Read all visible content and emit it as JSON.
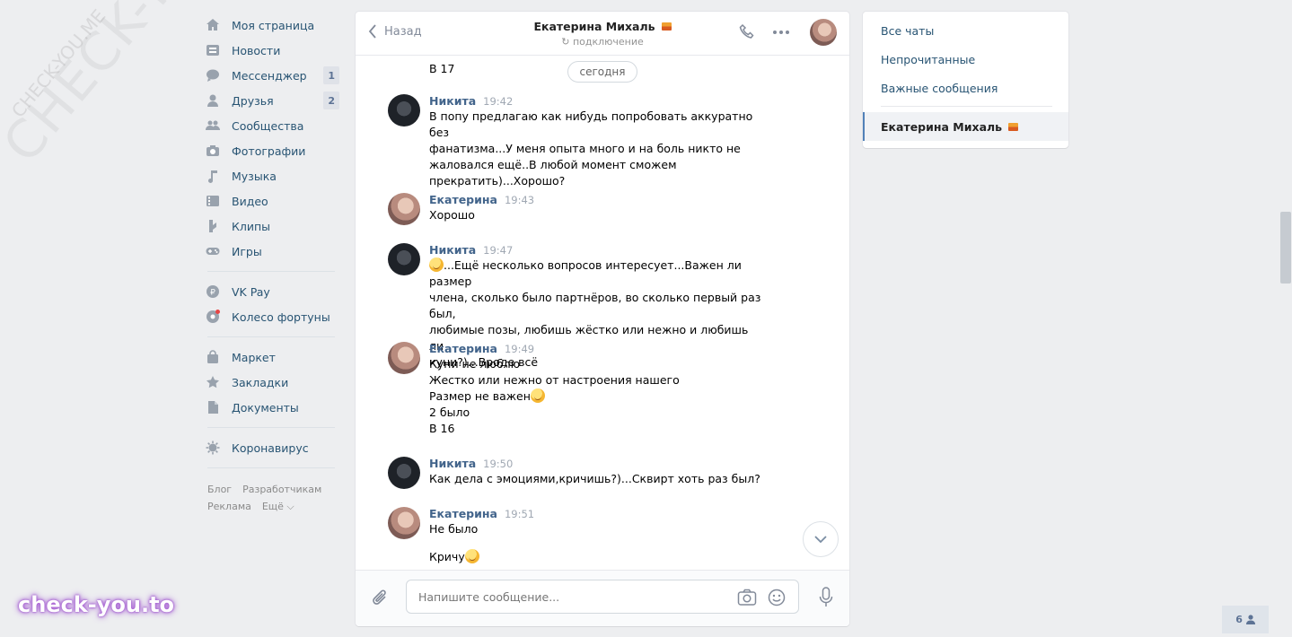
{
  "watermark": {
    "big": "CHECK-YOU.ME",
    "small": "CHECK-YOU.ME",
    "logo": "check-you.to"
  },
  "nav": {
    "items": [
      {
        "label": "Моя страница",
        "icon": "home-icon"
      },
      {
        "label": "Новости",
        "icon": "news-icon"
      },
      {
        "label": "Мессенджер",
        "icon": "messenger-icon",
        "count": "1"
      },
      {
        "label": "Друзья",
        "icon": "friends-icon",
        "count": "2"
      },
      {
        "label": "Сообщества",
        "icon": "groups-icon"
      },
      {
        "label": "Фотографии",
        "icon": "camera-icon"
      },
      {
        "label": "Музыка",
        "icon": "music-icon"
      },
      {
        "label": "Видео",
        "icon": "video-icon"
      },
      {
        "label": "Клипы",
        "icon": "clips-icon"
      },
      {
        "label": "Игры",
        "icon": "games-icon"
      }
    ],
    "pay": [
      {
        "label": "VK Pay",
        "icon": "vkpay-icon"
      },
      {
        "label": "Колесо фортуны",
        "icon": "wheel-icon"
      }
    ],
    "more": [
      {
        "label": "Маркет",
        "icon": "market-icon"
      },
      {
        "label": "Закладки",
        "icon": "bookmark-icon"
      },
      {
        "label": "Документы",
        "icon": "document-icon"
      }
    ],
    "corona": {
      "label": "Коронавирус",
      "icon": "virus-icon"
    },
    "footer": {
      "blog": "Блог",
      "dev": "Разработчикам",
      "ads": "Реклама",
      "more": "Ещё ⌵"
    }
  },
  "chat": {
    "back_label": "Назад",
    "name": "Екатерина Михаль",
    "status": "подключение",
    "date_pill": "сегодня",
    "top_continuation": "В 17",
    "messages": [
      {
        "author": "Никита",
        "time": "19:42",
        "lines": [
          "В попу предлагаю как нибудь попробовать аккуратно без",
          "фанатизма...У меня опыта много и на боль никто не",
          "жаловался ещё..В любой момент сможем",
          "прекратить)...Хорошо?"
        ]
      },
      {
        "author": "Екатерина",
        "time": "19:43",
        "lines": [
          "Хорошо"
        ]
      },
      {
        "author": "Никита",
        "time": "19:47",
        "lines": [
          "...Ещё несколько вопросов интересует...Важен ли размер",
          "члена, сколько было партнёров, во сколько первый раз был,",
          "любимые позы, любишь жёстко или нежно и любишь ли",
          "куни?)...Вроде всё"
        ]
      },
      {
        "author": "Екатерина",
        "time": "19:49",
        "lines": [
          "Куни не люблю",
          "Жестко или нежно от настроения нашего",
          "Размер не важен",
          "2 было",
          "В 16"
        ]
      },
      {
        "author": "Никита",
        "time": "19:50",
        "lines": [
          "Как дела с эмоциями,кричишь?)...Сквирт хоть раз был?"
        ]
      },
      {
        "author": "Екатерина",
        "time": "19:51",
        "lines": [
          "Не было",
          "",
          "Кричу"
        ]
      }
    ],
    "compose_placeholder": "Напишите сообщение..."
  },
  "right_panel": {
    "all": "Все чаты",
    "unread": "Непрочитанные",
    "important": "Важные сообщения",
    "active": "Екатерина Михаль"
  },
  "online_count": "6",
  "colors": {
    "link": "#285473",
    "author": "#42648b",
    "bg": "#edeef0"
  }
}
